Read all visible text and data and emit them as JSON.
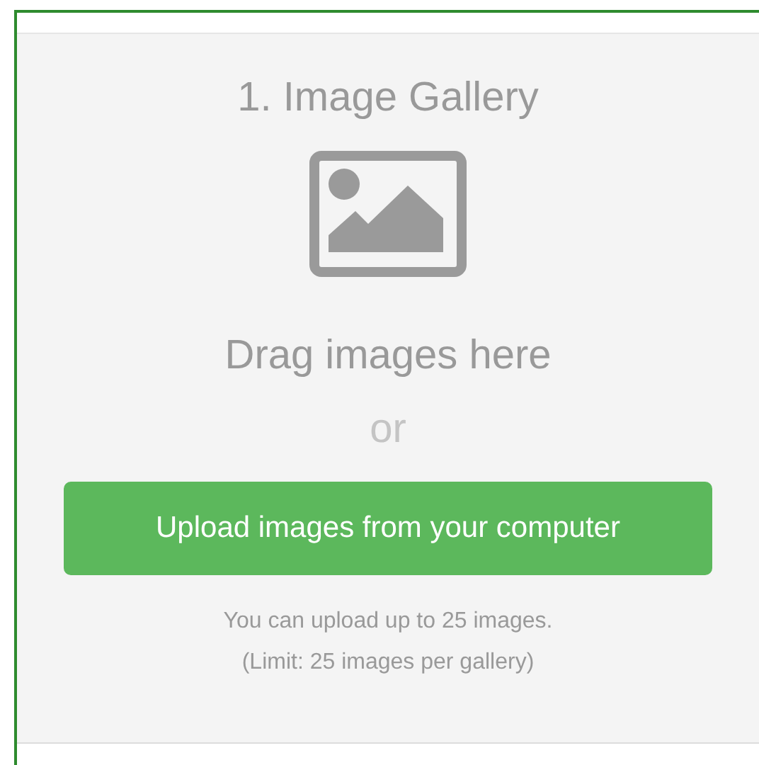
{
  "gallery": {
    "title": "1. Image Gallery",
    "drop_text": "Drag images here",
    "separator": "or",
    "upload_button": "Upload images from your computer",
    "notes": [
      "You can upload up to 25 images.",
      "(Limit: 25 images per gallery)"
    ]
  }
}
